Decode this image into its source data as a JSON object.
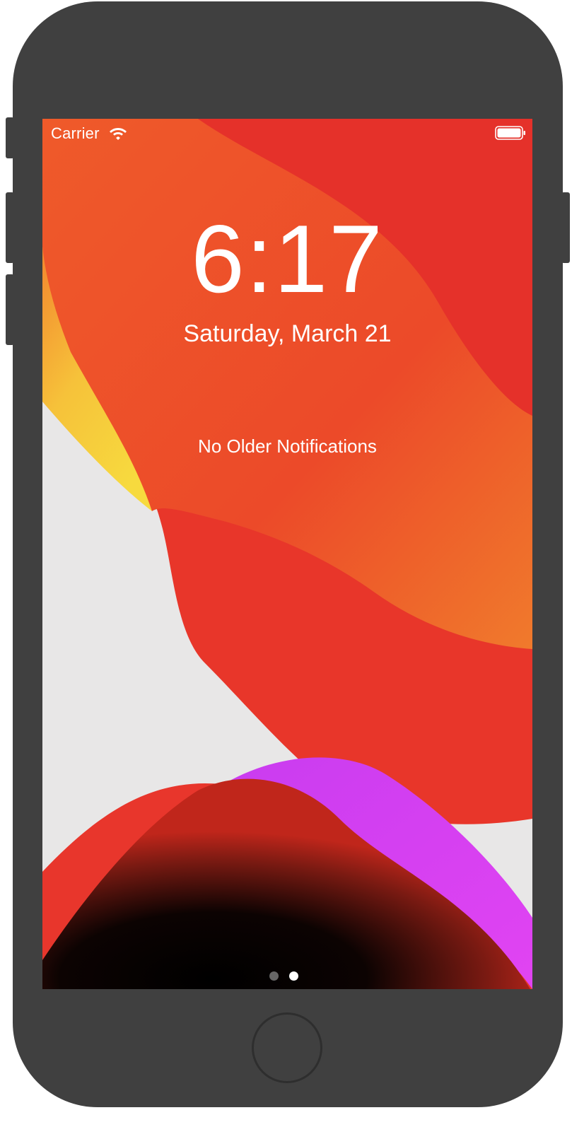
{
  "status_bar": {
    "carrier": "Carrier",
    "wifi_icon": "wifi-icon",
    "battery_icon": "battery-full-icon"
  },
  "lock_screen": {
    "time": "6:17",
    "date": "Saturday, March 21",
    "notifications_text": "No Older Notifications"
  },
  "page_indicator": {
    "pages": 2,
    "current_page": 2
  },
  "device": {
    "home_button_icon": "home-button",
    "body_color": "#404040"
  },
  "colors": {
    "wallpaper_red": "#e8372a",
    "wallpaper_orange": "#ef4f28",
    "wallpaper_yellow": "#f6d13c",
    "wallpaper_magenta": "#d642f2",
    "wallpaper_light": "#e8e7e7"
  }
}
